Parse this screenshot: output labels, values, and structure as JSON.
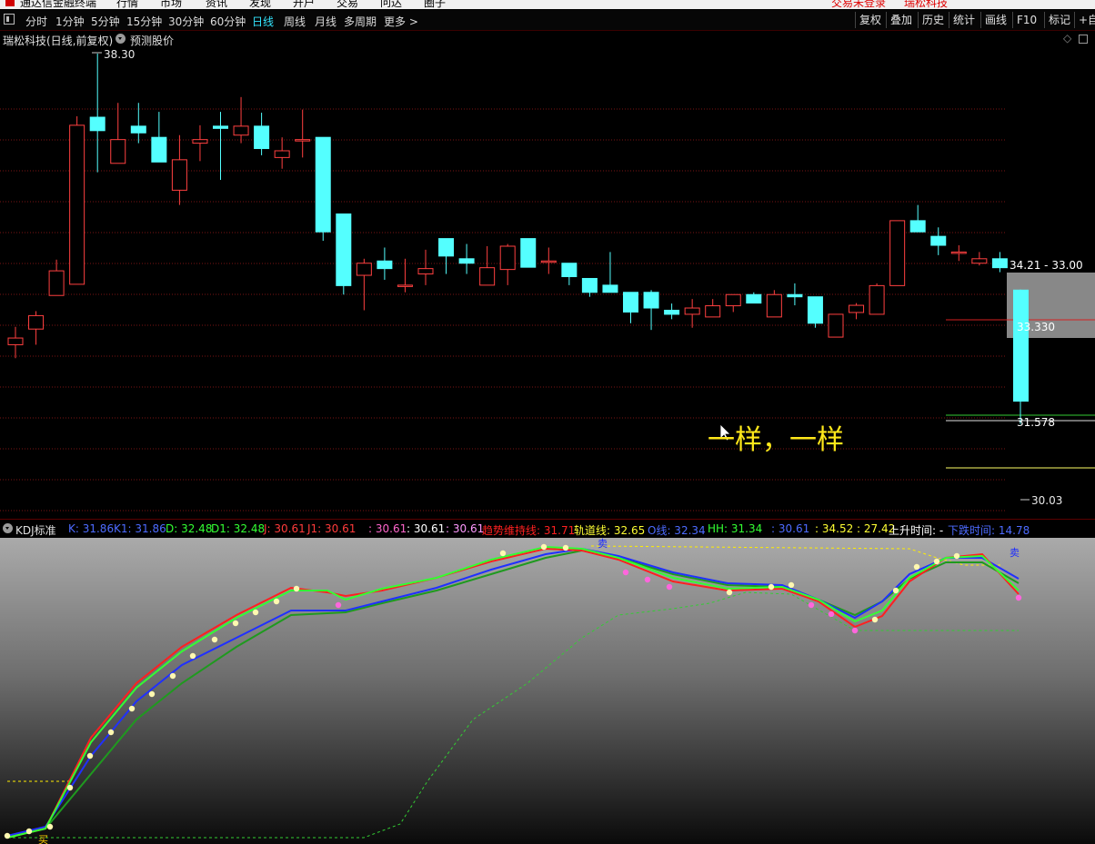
{
  "menubar": {
    "items": [
      "通达信金融终端",
      "行情",
      "市场",
      "资讯",
      "发现",
      "开户",
      "交易",
      "问达",
      "圈子"
    ],
    "login_status": "交易未登录",
    "stock": "瑞松科技"
  },
  "toolbar": {
    "timeframes": [
      "分时",
      "1分钟",
      "5分钟",
      "15分钟",
      "30分钟",
      "60分钟",
      "日线",
      "周线",
      "月线",
      "多周期",
      "更多 >"
    ],
    "active": "日线",
    "right_buttons": [
      "复权",
      "叠加",
      "历史",
      "统计",
      "画线",
      "F10",
      "标记",
      "+自"
    ]
  },
  "stock_bar": {
    "title": "瑞松科技(日线,前复权)",
    "predict_label": "预测股价"
  },
  "price_chart": {
    "high_label": "38.30",
    "low_label": "30.03",
    "range_label": "34.21 - 33.00",
    "level_1": "33.330",
    "level_2": "31.578",
    "annotation": "一样，一样"
  },
  "kdj": {
    "title": "KDJ标准",
    "items": [
      {
        "text": "K: 31.86",
        "color": "#4d6bff"
      },
      {
        "text": "K1: 31.86",
        "color": "#4d6bff"
      },
      {
        "text": "D: 32.48",
        "color": "#33ff33"
      },
      {
        "text": "D1: 32.48",
        "color": "#33ff33"
      },
      {
        "text": "J: 30.61",
        "color": "#ff3b3b"
      },
      {
        "text": "J1: 30.61",
        "color": "#ff3b3b"
      },
      {
        "text": ": 30.61",
        "color": "#ff66cc"
      },
      {
        "text": ": 30.61",
        "color": "#ffffff"
      },
      {
        "text": ": 30.61",
        "color": "#ff99ff"
      },
      {
        "text": "趋势维持线: 31.71",
        "color": "#ff2020"
      },
      {
        "text": "轨道线: 32.65",
        "color": "#ffff33"
      },
      {
        "text": "O线: 32.34",
        "color": "#4d6bff"
      },
      {
        "text": "HH: 31.34",
        "color": "#33ff33"
      },
      {
        "text": ": 30.61",
        "color": "#4d6bff"
      },
      {
        "text": ": 34.52 : 27.42",
        "color": "#ffff33"
      },
      {
        "text": "上升时间: -",
        "color": "#ffffff"
      },
      {
        "text": "下跌时间: 14.78",
        "color": "#4d6bff"
      }
    ],
    "signal_sell": "卖",
    "signal_buy": "买"
  },
  "chart_data": {
    "type": "candlestick",
    "bull_color": "#ff4040",
    "bear_color": "#54ffff",
    "candles": [
      {
        "o": 31.8,
        "c": 31.95,
        "h": 32.2,
        "l": 31.5
      },
      {
        "o": 32.15,
        "c": 32.45,
        "h": 32.55,
        "l": 31.8
      },
      {
        "o": 32.9,
        "c": 33.45,
        "h": 33.7,
        "l": 32.9
      },
      {
        "o": 33.15,
        "c": 36.7,
        "h": 36.9,
        "l": 33.15
      },
      {
        "o": 36.88,
        "c": 36.58,
        "h": 38.3,
        "l": 35.65
      },
      {
        "o": 35.85,
        "c": 36.38,
        "h": 37.2,
        "l": 35.85
      },
      {
        "o": 36.68,
        "c": 36.53,
        "h": 37.2,
        "l": 36.3
      },
      {
        "o": 36.43,
        "c": 35.88,
        "h": 37.0,
        "l": 35.88
      },
      {
        "o": 35.25,
        "c": 35.93,
        "h": 36.48,
        "l": 34.92
      },
      {
        "o": 36.3,
        "c": 36.38,
        "h": 36.7,
        "l": 35.9
      },
      {
        "o": 36.68,
        "c": 36.63,
        "h": 37.0,
        "l": 35.48
      },
      {
        "o": 36.48,
        "c": 36.68,
        "h": 37.33,
        "l": 36.3
      },
      {
        "o": 36.68,
        "c": 36.18,
        "h": 36.98,
        "l": 36.03
      },
      {
        "o": 35.98,
        "c": 36.13,
        "h": 36.43,
        "l": 35.73
      },
      {
        "o": 36.38,
        "c": 36.38,
        "h": 37.05,
        "l": 35.98
      },
      {
        "o": 36.43,
        "c": 34.32,
        "h": 36.43,
        "l": 34.12
      },
      {
        "o": 34.72,
        "c": 33.12,
        "h": 34.72,
        "l": 32.92
      },
      {
        "o": 33.35,
        "c": 33.62,
        "h": 33.72,
        "l": 32.57
      },
      {
        "o": 33.67,
        "c": 33.5,
        "h": 33.97,
        "l": 33.25
      },
      {
        "o": 33.13,
        "c": 33.13,
        "h": 33.72,
        "l": 32.97
      },
      {
        "o": 33.38,
        "c": 33.5,
        "h": 33.92,
        "l": 33.13
      },
      {
        "o": 34.17,
        "c": 33.78,
        "h": 34.17,
        "l": 33.38
      },
      {
        "o": 33.72,
        "c": 33.62,
        "h": 34.05,
        "l": 33.38
      },
      {
        "o": 33.13,
        "c": 33.52,
        "h": 34.0,
        "l": 33.13
      },
      {
        "o": 33.48,
        "c": 34.0,
        "h": 34.05,
        "l": 33.13
      },
      {
        "o": 34.17,
        "c": 33.53,
        "h": 34.17,
        "l": 33.53
      },
      {
        "o": 33.67,
        "c": 33.67,
        "h": 33.97,
        "l": 33.38
      },
      {
        "o": 33.62,
        "c": 33.32,
        "h": 33.62,
        "l": 33.13
      },
      {
        "o": 33.28,
        "c": 32.97,
        "h": 33.28,
        "l": 32.87
      },
      {
        "o": 33.13,
        "c": 32.97,
        "h": 33.87,
        "l": 32.97
      },
      {
        "o": 32.97,
        "c": 32.53,
        "h": 32.97,
        "l": 32.28
      },
      {
        "o": 32.97,
        "c": 32.62,
        "h": 33.02,
        "l": 32.13
      },
      {
        "o": 32.57,
        "c": 32.48,
        "h": 32.72,
        "l": 32.37
      },
      {
        "o": 32.48,
        "c": 32.62,
        "h": 32.82,
        "l": 32.18
      },
      {
        "o": 32.42,
        "c": 32.67,
        "h": 32.82,
        "l": 32.42
      },
      {
        "o": 32.67,
        "c": 32.92,
        "h": 32.92,
        "l": 32.53
      },
      {
        "o": 32.92,
        "c": 32.73,
        "h": 32.97,
        "l": 32.73
      },
      {
        "o": 32.42,
        "c": 32.92,
        "h": 33.02,
        "l": 32.42
      },
      {
        "o": 32.92,
        "c": 32.87,
        "h": 33.17,
        "l": 32.68
      },
      {
        "o": 32.87,
        "c": 32.28,
        "h": 32.87,
        "l": 32.18
      },
      {
        "o": 31.97,
        "c": 32.48,
        "h": 32.48,
        "l": 31.97
      },
      {
        "o": 32.52,
        "c": 32.68,
        "h": 32.73,
        "l": 32.37
      },
      {
        "o": 32.48,
        "c": 33.12,
        "h": 33.17,
        "l": 32.48
      },
      {
        "o": 33.12,
        "c": 34.57,
        "h": 34.57,
        "l": 33.12
      },
      {
        "o": 34.57,
        "c": 34.32,
        "h": 34.92,
        "l": 34.32
      },
      {
        "o": 34.22,
        "c": 34.02,
        "h": 34.42,
        "l": 33.8
      },
      {
        "o": 33.87,
        "c": 33.87,
        "h": 34.02,
        "l": 33.67
      },
      {
        "o": 33.62,
        "c": 33.72,
        "h": 33.87,
        "l": 33.57
      },
      {
        "o": 33.72,
        "c": 33.52,
        "h": 33.87,
        "l": 33.42
      }
    ],
    "projection": {
      "open": 33.03,
      "close": 30.53,
      "high": 33.03,
      "low": 30.03
    },
    "predict_zone": [
      33.0,
      34.21
    ],
    "levels": [
      33.33,
      31.578
    ]
  }
}
